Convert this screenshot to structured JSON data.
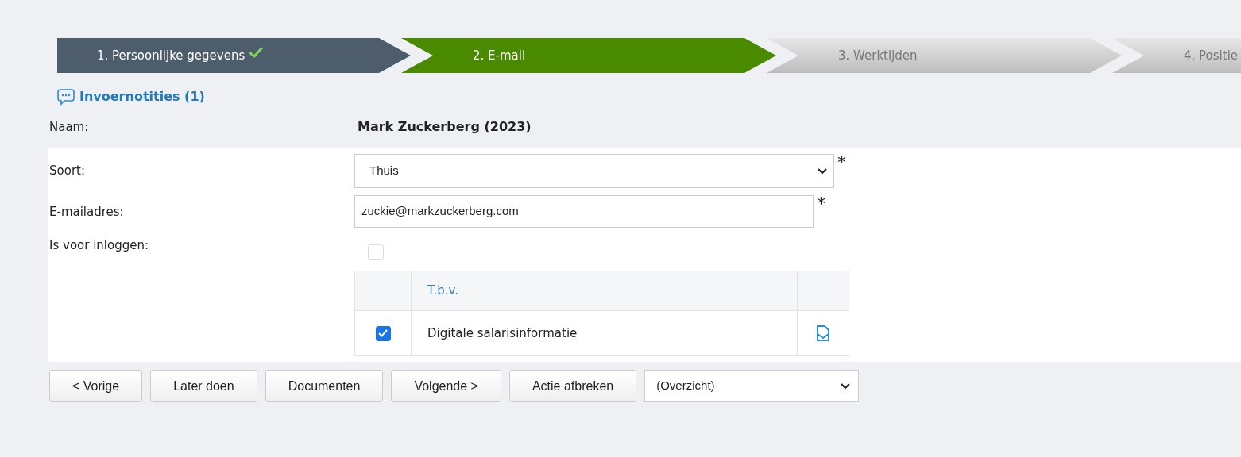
{
  "steps": [
    {
      "label": "1. Persoonlijke gegevens",
      "done": true,
      "selected": false
    },
    {
      "label": "2. E-mail",
      "done": false,
      "selected": true
    },
    {
      "label": "3. Werktijden",
      "done": false,
      "selected": false
    },
    {
      "label": "4. Positie",
      "done": false,
      "selected": false
    }
  ],
  "notes_link": "Invoernotities (1)",
  "name_row": {
    "label": "Naam:",
    "value": "Mark Zuckerberg (2023)"
  },
  "form": {
    "type": {
      "label": "Soort:",
      "value": "Thuis",
      "required_mark": "*"
    },
    "email": {
      "label": "E-mailadres:",
      "value": "zuckie@markzuckerberg.com",
      "required_mark": "*"
    },
    "login": {
      "label": "Is voor inloggen:",
      "checked": false,
      "disabled": true
    },
    "table": {
      "columns": [
        "T.b.v."
      ],
      "rows": [
        {
          "checked": true,
          "label": "Digitale salarisinformatie"
        }
      ]
    }
  },
  "buttons": [
    "< Vorige",
    "Later doen",
    "Documenten",
    "Volgende >",
    "Actie afbreken"
  ],
  "view_select": {
    "value": "(Overzicht)"
  }
}
